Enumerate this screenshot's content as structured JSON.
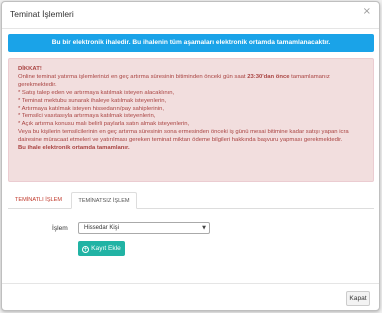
{
  "modal": {
    "title": "Teminat İşlemleri",
    "close_symbol": "×"
  },
  "info_box": {
    "bold_text": "Bu bir elektronik ihaledir.",
    "text": " Bu ihalenin tüm aşamaları elektronik ortamda tamamlanacaktır."
  },
  "warning": {
    "title": "DİKKAT!",
    "intro_pre": "Online teminat yatırma işlemlerinizi en geç artırma süresinin bitiminden önceki gün saat ",
    "intro_bold": "23:30'dan önce",
    "intro_post": " tamamlamanız gerekmektedir.",
    "items": [
      "* Satış talep eden ve artırmaya katılmak isteyen alacaklının,",
      "* Teminat mektubu sunarak ihaleye katılmak isteyenlerin,",
      "* Artırmaya katılmak isteyen hissedarın/pay sahiplerinin,",
      "* Temsilci vasıtasıyla artırmaya katılmak isteyenlerin,",
      "* Açık artırma konusu malı belirli paylarla satın almak isteyenlerin,"
    ],
    "para": "Veya bu kişilerin temsilcilerinin en geç artırma süresinin sona ermesinden önceki iş günü mesai bitimine kadar satışı yapan icra dairesine müracaat etmeleri ve yatırılması gereken teminat miktarı ödeme bilgileri hakkında başvuru yapması gerekmektedir.",
    "final": "Bu ihale elektronik ortamda tamamlanır."
  },
  "tabs": [
    {
      "label": "TEMİNATLI İŞLEM",
      "active": false
    },
    {
      "label": "TEMİNATSIZ İŞLEM",
      "active": true
    }
  ],
  "form": {
    "label": "İşlem",
    "select_value": "Hissedar Kişi",
    "add_button": "Kayıt Ekle"
  },
  "footer": {
    "close_button": "Kapat"
  },
  "colors": {
    "info_bg": "#1aa3e8",
    "warning_bg": "#f2dede",
    "warning_text": "#a94442",
    "add_button_bg": "#21b3a4",
    "tab_inactive_text": "#c0392b"
  }
}
